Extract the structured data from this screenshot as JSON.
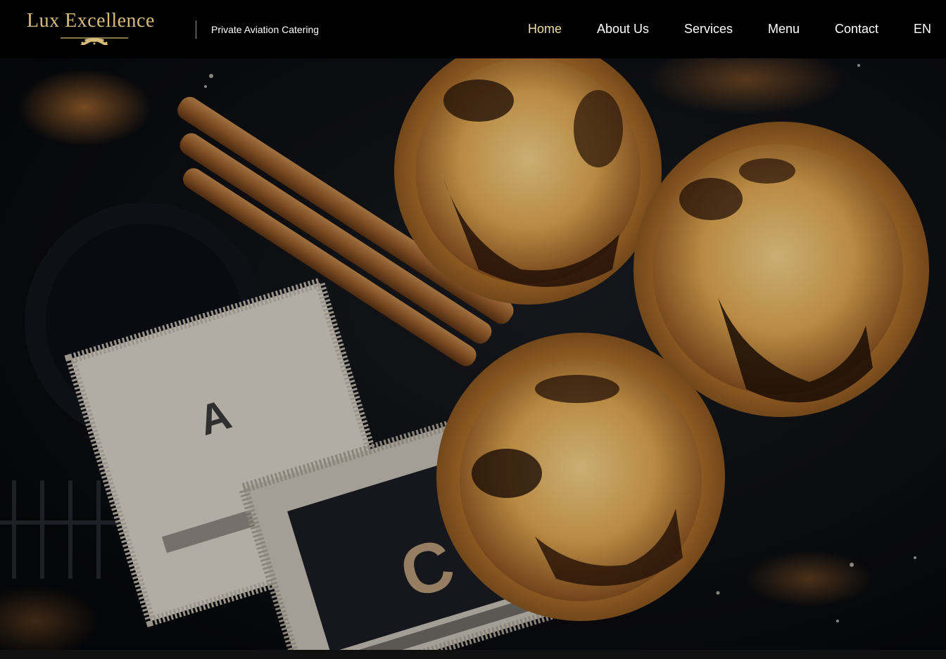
{
  "brand": {
    "name": "Lux Excellence",
    "tagline": "Private Aviation Catering",
    "gold": "#d8bd7a"
  },
  "nav": {
    "items": [
      {
        "label": "Home",
        "active": true
      },
      {
        "label": "About Us",
        "active": false
      },
      {
        "label": "Services",
        "active": false
      },
      {
        "label": "Menu",
        "active": false
      },
      {
        "label": "Contact",
        "active": false
      }
    ],
    "language": "EN",
    "active_color": "#f1df9e"
  },
  "hero": {
    "image_subject": "pastel-de-nata-tarts-cinnamon-sugar-sachets",
    "stamp_letters": [
      "A",
      "C"
    ]
  }
}
